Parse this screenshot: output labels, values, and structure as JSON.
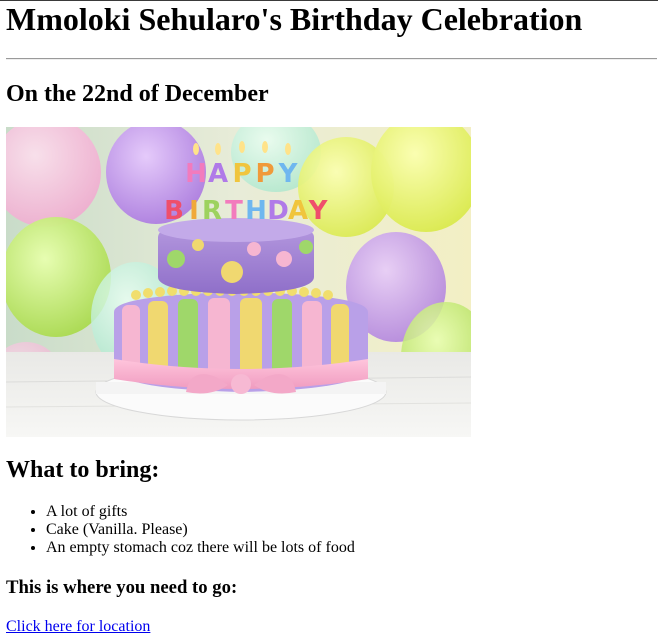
{
  "page": {
    "title": "Mmoloki Sehularo's Birthday Celebration",
    "date_heading": "On the 22nd of December",
    "bring_heading": "What to bring:",
    "bring_items": [
      "A lot of gifts",
      "Cake (Vanilla. Please)",
      "An empty stomach coz there will be lots of food"
    ],
    "go_heading": "This is where you need to go:",
    "location_link": "Click here for location"
  },
  "image": {
    "subject": "birthday-cake",
    "alt": "",
    "cake_letters": [
      "H",
      "A",
      "P",
      "P",
      "Y",
      "B",
      "I",
      "R",
      "T",
      "H",
      "D",
      "A",
      "Y"
    ]
  },
  "colors": {
    "link": "#0000ee",
    "text": "#000000"
  }
}
